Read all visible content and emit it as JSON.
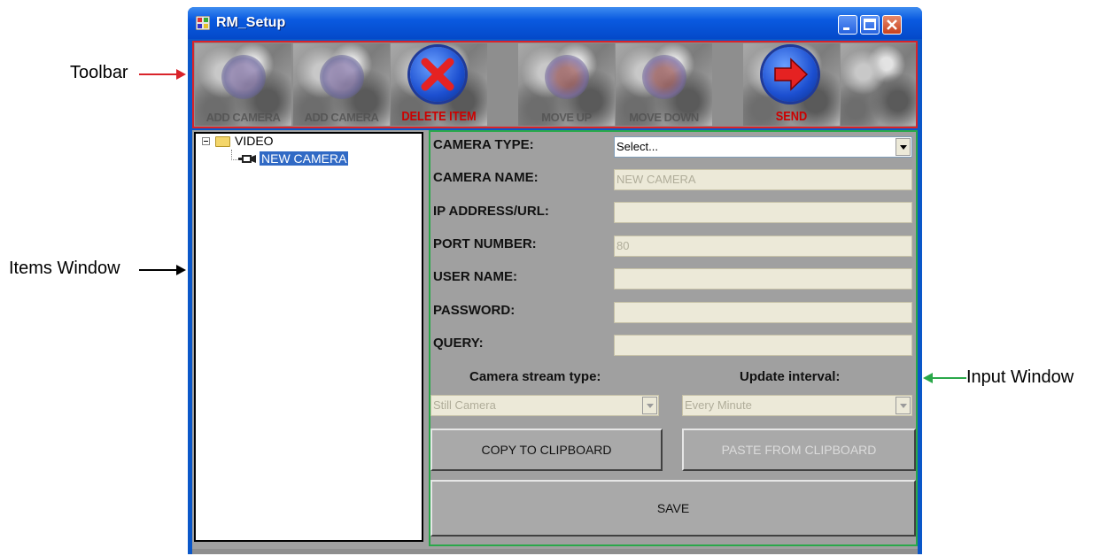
{
  "annotations": {
    "toolbar": "Toolbar",
    "items_window": "Items Window",
    "input_window": "Input Window",
    "colors": {
      "toolbar": "#d9232a",
      "items_window": "#000000",
      "input_window": "#2aa84a"
    }
  },
  "window": {
    "title": "RM_Setup"
  },
  "toolbar": {
    "buttons": [
      {
        "icon": "add-camera-icon",
        "label": "ADD CAMERA",
        "enabled": false
      },
      {
        "icon": "add-camera-icon",
        "label": "ADD CAMERA",
        "enabled": false
      },
      {
        "icon": "delete-icon",
        "label": "DELETE ITEM",
        "enabled": true
      },
      {
        "icon": "move-up-icon",
        "label": "MOVE UP",
        "enabled": false
      },
      {
        "icon": "move-down-icon",
        "label": "MOVE DOWN",
        "enabled": false
      },
      {
        "icon": "send-icon",
        "label": "SEND",
        "enabled": true
      },
      {
        "icon": "blank-icon",
        "label": "",
        "enabled": false
      }
    ]
  },
  "tree": {
    "root": "VIDEO",
    "child": "NEW CAMERA"
  },
  "form": {
    "camera_type": {
      "label": "CAMERA TYPE:",
      "value": "Select..."
    },
    "camera_name": {
      "label": "CAMERA NAME:",
      "value": "NEW CAMERA"
    },
    "ip_address": {
      "label": "IP ADDRESS/URL:",
      "value": ""
    },
    "port_number": {
      "label": "PORT NUMBER:",
      "value": "80"
    },
    "user_name": {
      "label": "USER NAME:",
      "value": ""
    },
    "password": {
      "label": "PASSWORD:",
      "value": ""
    },
    "query": {
      "label": "QUERY:",
      "value": ""
    },
    "stream_type": {
      "label": "Camera stream type:",
      "value": "Still Camera"
    },
    "update_interval": {
      "label": "Update interval:",
      "value": "Every Minute"
    }
  },
  "buttons": {
    "copy": "COPY TO CLIPBOARD",
    "paste": "PASTE FROM CLIPBOARD",
    "save": "SAVE"
  }
}
